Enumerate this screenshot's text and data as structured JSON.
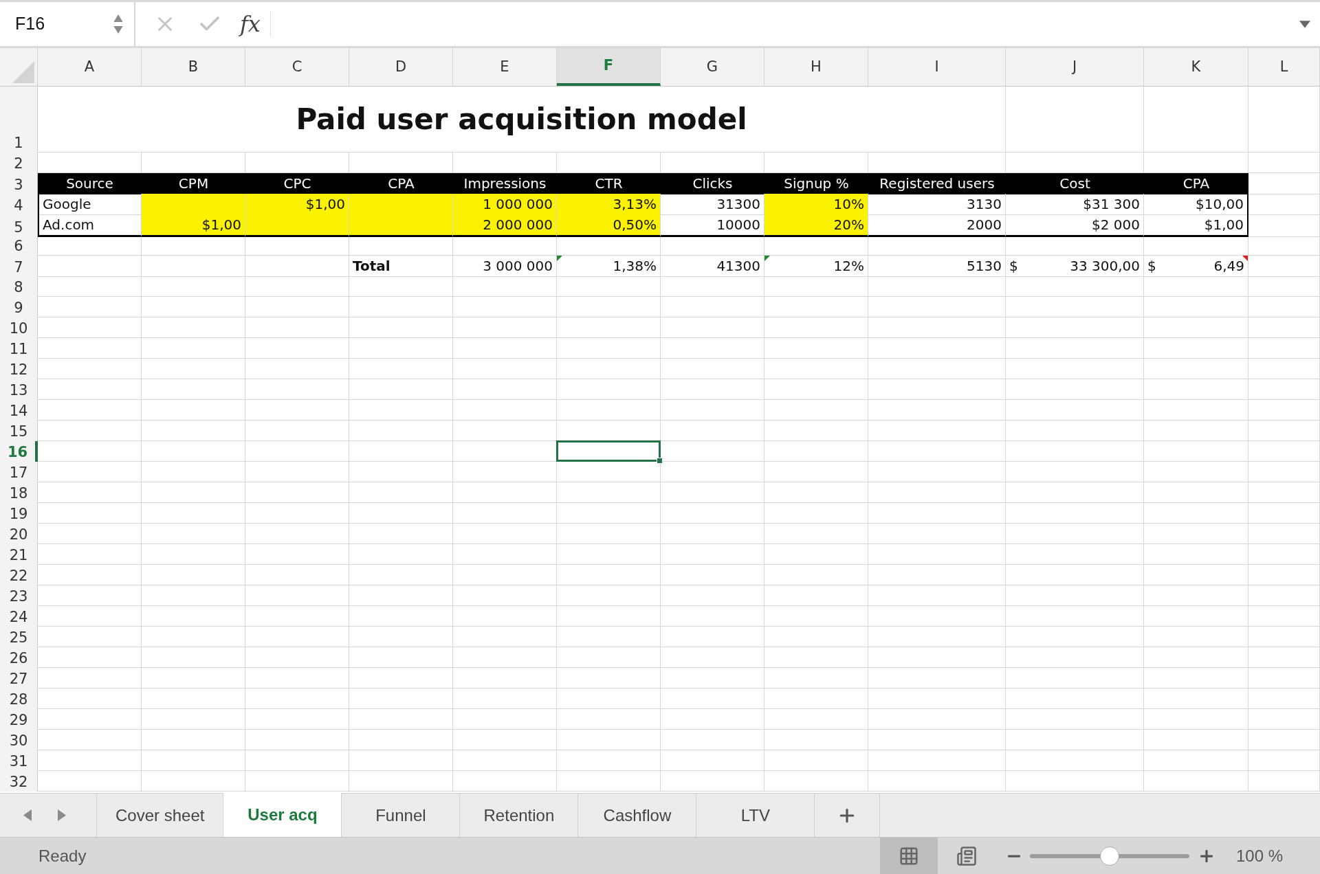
{
  "formula_bar": {
    "name_box": "F16",
    "function_label": "fx"
  },
  "columns": [
    {
      "label": "A",
      "selected": false
    },
    {
      "label": "B",
      "selected": false
    },
    {
      "label": "C",
      "selected": false
    },
    {
      "label": "D",
      "selected": false
    },
    {
      "label": "E",
      "selected": false
    },
    {
      "label": "F",
      "selected": true
    },
    {
      "label": "G",
      "selected": false
    },
    {
      "label": "H",
      "selected": false
    },
    {
      "label": "I",
      "selected": false
    },
    {
      "label": "J",
      "selected": false
    },
    {
      "label": "K",
      "selected": false
    },
    {
      "label": "L",
      "selected": false
    }
  ],
  "rows": [
    {
      "number": "1",
      "selected": false,
      "kind": "title",
      "title": "Paid user acquisition model"
    },
    {
      "number": "2",
      "selected": false
    },
    {
      "number": "3",
      "selected": false,
      "kind": "header",
      "cells": [
        {
          "text": "Source"
        },
        {
          "text": "CPM"
        },
        {
          "text": "CPC"
        },
        {
          "text": "CPA"
        },
        {
          "text": "Impressions"
        },
        {
          "text": "CTR"
        },
        {
          "text": "Clicks"
        },
        {
          "text": "Signup %"
        },
        {
          "text": "Registered users"
        },
        {
          "text": "Cost"
        },
        {
          "text": "CPA"
        }
      ]
    },
    {
      "number": "4",
      "selected": false,
      "kind": "data",
      "cells": [
        {
          "text": "Google",
          "kind": "label",
          "highlighted": false
        },
        {
          "highlighted": true
        },
        {
          "text": "$1,00",
          "highlighted": true
        },
        {
          "highlighted": true
        },
        {
          "text": "1 000 000",
          "highlighted": true
        },
        {
          "text": "3,13%",
          "highlighted": true
        },
        {
          "text": "31300",
          "highlighted": false
        },
        {
          "text": "10%",
          "highlighted": true
        },
        {
          "text": "3130",
          "highlighted": false
        },
        {
          "text": "$31 300",
          "highlighted": false
        },
        {
          "text": "$10,00",
          "highlighted": false
        }
      ]
    },
    {
      "number": "5",
      "selected": false,
      "kind": "data",
      "cells": [
        {
          "text": "Ad.com",
          "kind": "label",
          "highlighted": false
        },
        {
          "text": "$1,00",
          "highlighted": true
        },
        {
          "highlighted": true
        },
        {
          "highlighted": true
        },
        {
          "text": "2 000 000",
          "highlighted": true
        },
        {
          "text": "0,50%",
          "highlighted": true
        },
        {
          "text": "10000",
          "highlighted": false
        },
        {
          "text": "20%",
          "highlighted": true
        },
        {
          "text": "2000",
          "highlighted": false
        },
        {
          "text": "$2 000",
          "highlighted": false
        },
        {
          "text": "$1,00",
          "highlighted": false
        }
      ]
    },
    {
      "number": "6",
      "selected": false
    },
    {
      "number": "7",
      "selected": false,
      "kind": "plain",
      "cells": [
        {},
        {},
        {},
        {
          "text": "Total",
          "kind": "label",
          "bold": true
        },
        {
          "text": "3 000 000"
        },
        {
          "text": "1,38%",
          "error_flag": true
        },
        {
          "text": "41300"
        },
        {
          "text": "12%",
          "error_flag": true
        },
        {
          "text": "5130"
        },
        {
          "currency": "$",
          "text": "33 300,00"
        },
        {
          "currency": "$",
          "text": "6,49",
          "comment_flag": true
        }
      ]
    },
    {
      "number": "8",
      "selected": false
    },
    {
      "number": "9",
      "selected": false
    },
    {
      "number": "10",
      "selected": false
    },
    {
      "number": "11",
      "selected": false
    },
    {
      "number": "12",
      "selected": false
    },
    {
      "number": "13",
      "selected": false
    },
    {
      "number": "14",
      "selected": false
    },
    {
      "number": "15",
      "selected": false
    },
    {
      "number": "16",
      "selected": true
    },
    {
      "number": "17",
      "selected": false
    },
    {
      "number": "18",
      "selected": false
    },
    {
      "number": "19",
      "selected": false
    },
    {
      "number": "20",
      "selected": false
    },
    {
      "number": "21",
      "selected": false
    },
    {
      "number": "22",
      "selected": false
    },
    {
      "number": "23",
      "selected": false
    },
    {
      "number": "24",
      "selected": false
    },
    {
      "number": "25",
      "selected": false
    },
    {
      "number": "26",
      "selected": false
    },
    {
      "number": "27",
      "selected": false
    },
    {
      "number": "28",
      "selected": false
    },
    {
      "number": "29",
      "selected": false
    },
    {
      "number": "30",
      "selected": false
    },
    {
      "number": "31",
      "selected": false
    },
    {
      "number": "32",
      "selected": false
    }
  ],
  "sheet_tabs": [
    {
      "label": "Cover sheet",
      "selected": false
    },
    {
      "label": "User acq",
      "selected": true
    },
    {
      "label": "Funnel",
      "selected": false
    },
    {
      "label": "Retention",
      "selected": false
    },
    {
      "label": "Cashflow",
      "selected": false
    },
    {
      "label": "LTV",
      "selected": false
    }
  ],
  "status_bar": {
    "status": "Ready",
    "view_buttons": [
      {
        "kind": "normal",
        "selected": true
      },
      {
        "kind": "page",
        "selected": false
      }
    ],
    "zoom": {
      "level": 0.5,
      "reading": "100 %"
    }
  }
}
